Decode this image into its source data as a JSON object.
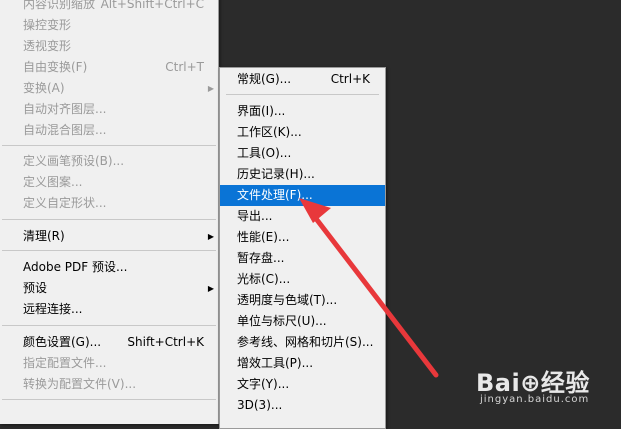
{
  "main_menu": {
    "items": [
      {
        "label": "内容识别缩放",
        "shortcut": "Alt+Shift+Ctrl+C",
        "state": "disabled"
      },
      {
        "label": "操控变形",
        "shortcut": "",
        "state": "disabled"
      },
      {
        "label": "透视变形",
        "shortcut": "",
        "state": "disabled"
      },
      {
        "label": "自由变换(F)",
        "shortcut": "Ctrl+T",
        "state": "disabled"
      },
      {
        "label": "变换(A)",
        "shortcut": "",
        "state": "disabled",
        "submenu": true
      },
      {
        "label": "自动对齐图层...",
        "shortcut": "",
        "state": "disabled"
      },
      {
        "label": "自动混合图层...",
        "shortcut": "",
        "state": "disabled"
      },
      {
        "label": "定义画笔预设(B)...",
        "shortcut": "",
        "state": "disabled"
      },
      {
        "label": "定义图案...",
        "shortcut": "",
        "state": "disabled"
      },
      {
        "label": "定义自定形状...",
        "shortcut": "",
        "state": "disabled"
      },
      {
        "label": "清理(R)",
        "shortcut": "",
        "state": "enabled",
        "submenu": true
      },
      {
        "label": "Adobe PDF 预设...",
        "shortcut": "",
        "state": "enabled"
      },
      {
        "label": "预设",
        "shortcut": "",
        "state": "enabled",
        "submenu": true
      },
      {
        "label": "远程连接...",
        "shortcut": "",
        "state": "enabled"
      },
      {
        "label": "颜色设置(G)...",
        "shortcut": "Shift+Ctrl+K",
        "state": "enabled"
      },
      {
        "label": "指定配置文件...",
        "shortcut": "",
        "state": "disabled"
      },
      {
        "label": "转换为配置文件(V)...",
        "shortcut": "",
        "state": "disabled"
      }
    ]
  },
  "sub_menu": {
    "items": [
      {
        "label": "常规(G)...",
        "shortcut": "Ctrl+K"
      },
      {
        "label": "界面(I)...",
        "shortcut": ""
      },
      {
        "label": "工作区(K)...",
        "shortcut": ""
      },
      {
        "label": "工具(O)...",
        "shortcut": ""
      },
      {
        "label": "历史记录(H)...",
        "shortcut": ""
      },
      {
        "label": "文件处理(F)...",
        "shortcut": "",
        "highlighted": true
      },
      {
        "label": "导出...",
        "shortcut": ""
      },
      {
        "label": "性能(E)...",
        "shortcut": ""
      },
      {
        "label": "暂存盘...",
        "shortcut": ""
      },
      {
        "label": "光标(C)...",
        "shortcut": ""
      },
      {
        "label": "透明度与色域(T)...",
        "shortcut": ""
      },
      {
        "label": "单位与标尺(U)...",
        "shortcut": ""
      },
      {
        "label": "参考线、网格和切片(S)...",
        "shortcut": ""
      },
      {
        "label": "增效工具(P)...",
        "shortcut": ""
      },
      {
        "label": "文字(Y)...",
        "shortcut": ""
      },
      {
        "label": "3D(3)...",
        "shortcut": ""
      }
    ]
  },
  "watermark": {
    "logo": "Bai⊕经验",
    "url": "jingyan.baidu.com"
  },
  "colors": {
    "background": "#2b2b2b",
    "menu_bg": "#f0f0f0",
    "highlight": "#0a74d6",
    "arrow": "#e8383b"
  },
  "icons": [
    "submenu-arrow-icon",
    "red-arrow-annotation",
    "baidu-paw-icon"
  ]
}
